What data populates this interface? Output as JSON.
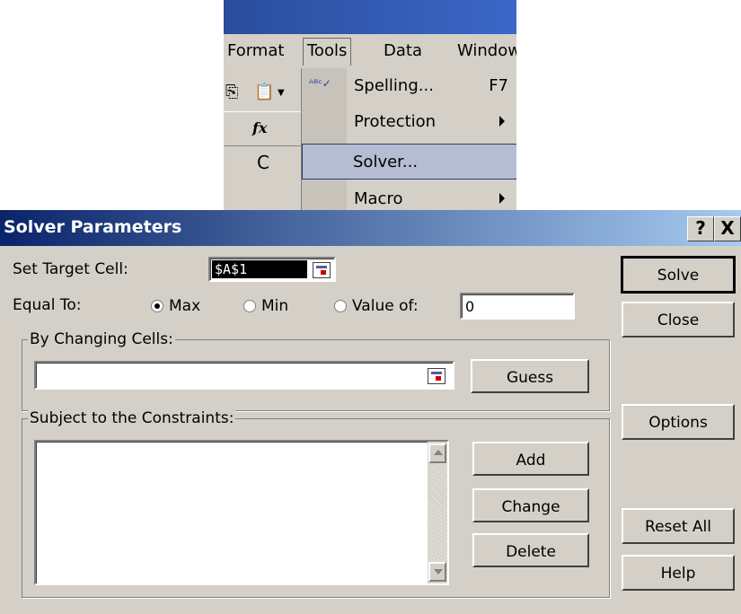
{
  "menubar": {
    "items": [
      {
        "label": "Format"
      },
      {
        "label": "Tools"
      },
      {
        "label": "Data"
      },
      {
        "label": "Window"
      }
    ]
  },
  "formula_bar": {
    "fx": "fx"
  },
  "column_header": "C",
  "tools_menu": {
    "items": [
      {
        "label": "Spelling...",
        "shortcut": "F7",
        "icon": "spelling-check-icon"
      },
      {
        "label": "Protection",
        "submenu": true
      },
      {
        "label": "Solver...",
        "highlighted": true
      },
      {
        "label": "Macro",
        "submenu": true
      }
    ]
  },
  "dialog": {
    "title": "Solver Parameters",
    "help_button": "?",
    "close_button": "X",
    "set_target_cell_label": "Set Target Cell:",
    "set_target_cell_value": "$A$1",
    "equal_to_label": "Equal To:",
    "options": {
      "max": "Max",
      "min": "Min",
      "value_of": "Value of:",
      "selected": "max"
    },
    "value_of_value": "0",
    "by_changing_cells_label": "By Changing Cells:",
    "by_changing_cells_value": "",
    "constraints_label": "Subject to the Constraints:",
    "buttons": {
      "solve": "Solve",
      "close": "Close",
      "guess": "Guess",
      "options": "Options",
      "add": "Add",
      "change": "Change",
      "delete": "Delete",
      "reset_all": "Reset All",
      "help": "Help"
    }
  }
}
